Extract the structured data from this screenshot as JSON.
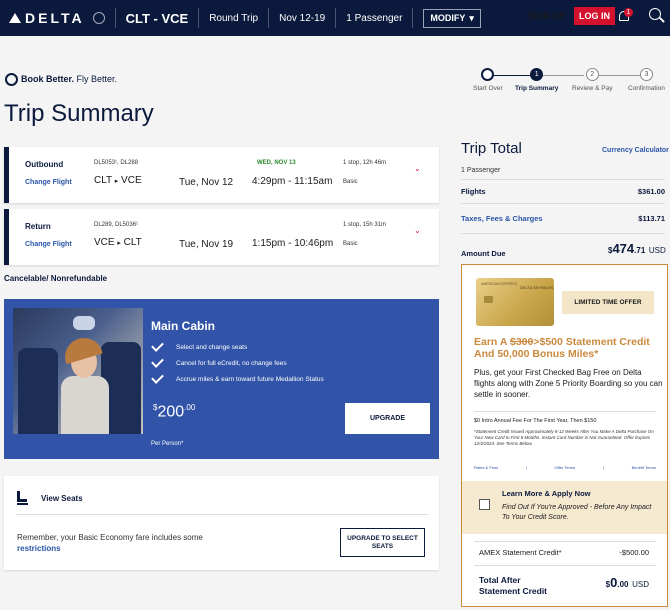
{
  "nav": {
    "brand": "DELTA",
    "route": "CLT - VCE",
    "trip_type": "Round Trip",
    "dates": "Nov 12-19",
    "passengers": "1 Passenger",
    "modify_label": "MODIFY",
    "signup_label": "SIGN UP",
    "login_label": "LOG IN",
    "notification_count": "1"
  },
  "book_better": {
    "bold": "Book Better.",
    "rest": " Fly Better."
  },
  "page_title": "Trip Summary",
  "stepper": [
    {
      "label": "Start Over",
      "number": "",
      "state": "start"
    },
    {
      "label": "Trip Summary",
      "number": "1",
      "state": "current"
    },
    {
      "label": "Review & Pay",
      "number": "2",
      "state": "upcoming"
    },
    {
      "label": "Confirmation",
      "number": "3",
      "state": "upcoming"
    }
  ],
  "flights": [
    {
      "direction": "Outbound",
      "change_label": "Change Flight",
      "flight_numbers": "DL5053¹, DL288",
      "route_from": "CLT",
      "route_to": "VCE",
      "date": "Tue, Nov 12",
      "arrival_note": "WED, NOV 13",
      "times": "4:29pm - 11:15am",
      "stops": "1 stop, 12h 46m",
      "fare_class": "Basic"
    },
    {
      "direction": "Return",
      "change_label": "Change Flight",
      "flight_numbers": "DL289, DL5036¹",
      "route_from": "VCE",
      "route_to": "CLT",
      "date": "Tue, Nov 19",
      "arrival_note": "",
      "times": "1:15pm - 10:46pm",
      "stops": "1 stop, 15h 31m",
      "fare_class": "Basic"
    }
  ],
  "cancelable_note": "Cancelable/ Nonrefundable",
  "main_cabin": {
    "title": "Main Cabin",
    "features": [
      "Select and change seats",
      "Cancel for full eCredit, no change fees",
      "Accrue miles & earn toward future Medallion Status"
    ],
    "price_currency": "$",
    "price_whole": "200",
    "price_cents": ".00",
    "per_person": "Per Person*",
    "upgrade_label": "UPGRADE"
  },
  "view_seats": {
    "title": "View Seats",
    "text": "Remember, your Basic Economy fare includes some",
    "link": "restrictions",
    "button_label": "UPGRADE TO SELECT SEATS"
  },
  "trip_total": {
    "title": "Trip Total",
    "calc_link": "Currency Calculator",
    "passengers": "1 Passenger",
    "flights_label": "Flights",
    "flights_value": "$361.00",
    "taxes_label": "Taxes, Fees & Charges",
    "taxes_value": "$113.71",
    "amount_label": "Amount Due",
    "amount_currency": "$",
    "amount_whole": "474",
    "amount_cents": ".71",
    "amount_code": "USD"
  },
  "offer": {
    "card_issuer": "AMERICAN EXPRESS",
    "card_name": "DELTA SKYMILES",
    "badge": "LIMITED TIME OFFER",
    "head_pre": "Earn A ",
    "head_strike": "$300",
    "head_post": ">$500 Statement Credit And 50,000 Bonus Miles*",
    "body": "Plus, get your First Checked Bag Free on Delta flights along with Zone 5 Priority Boarding so you can settle in sooner.",
    "fine1": "$0 Intro Annual Fee For The First Year, Then $150",
    "fine2": "*Statement Credit Issued Approximately 8-12 Weeks After You Make A Delta Purchase On Your New Card In First 6 Months. Instant Card Number is Not Guaranteed. Offer Expires 12/4/2024. See Terms Below.",
    "links": [
      "Rates & Fees",
      "Offer Terms",
      "Benefit Terms"
    ],
    "apply_title": "Learn More & Apply Now",
    "apply_sub": "Find Out If You're Approved - Before Any Impact To Your Credit Score.",
    "credit_label": "AMEX Statement Credit*",
    "credit_value": "-$500.00",
    "total_label": "Total After Statement Credit",
    "total_currency": "$",
    "total_whole": "0",
    "total_cents": ".00",
    "total_code": "USD"
  },
  "colors": {
    "navy": "#0b1a3c",
    "red": "#d4122e",
    "cabin_blue": "#3154a8",
    "link_blue": "#2a55a8",
    "offer_gold": "#c98a3e"
  }
}
